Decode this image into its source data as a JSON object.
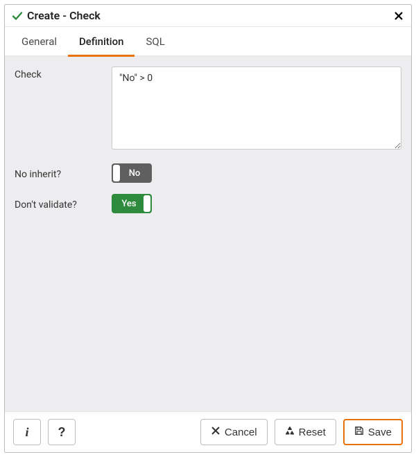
{
  "dialog": {
    "title": "Create - Check"
  },
  "tabs": {
    "general": "General",
    "definition": "Definition",
    "sql": "SQL",
    "active": "definition"
  },
  "form": {
    "check_label": "Check",
    "check_value": "\"No\" > 0",
    "no_inherit_label": "No inherit?",
    "no_inherit_value": "No",
    "dont_validate_label": "Don't validate?",
    "dont_validate_value": "Yes"
  },
  "footer": {
    "info": "i",
    "help": "?",
    "cancel": "Cancel",
    "reset": "Reset",
    "save": "Save"
  }
}
